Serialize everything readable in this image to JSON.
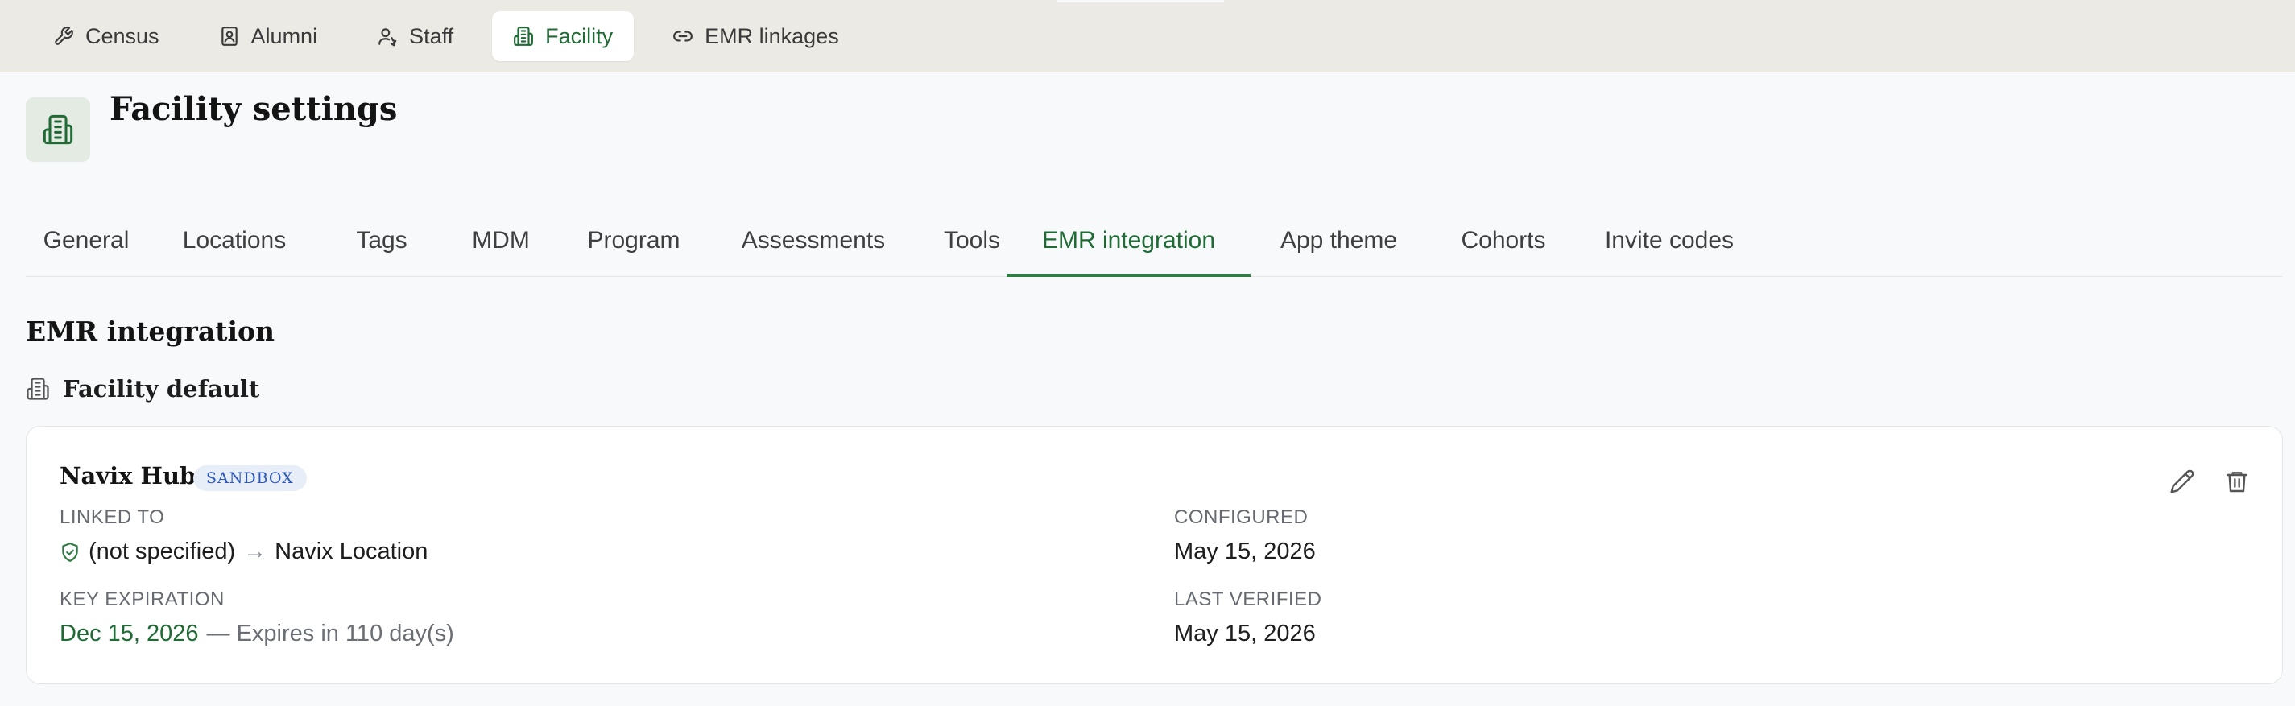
{
  "topnav": {
    "items": [
      {
        "label": "Census",
        "icon": "wrench-icon"
      },
      {
        "label": "Alumni",
        "icon": "contact-card-icon"
      },
      {
        "label": "Staff",
        "icon": "user-icon"
      },
      {
        "label": "Facility",
        "icon": "building-icon",
        "active": true
      },
      {
        "label": "EMR linkages",
        "icon": "link-icon"
      }
    ]
  },
  "header": {
    "title": "Facility settings",
    "icon": "building-icon"
  },
  "tabs": [
    {
      "label": "General"
    },
    {
      "label": "Locations"
    },
    {
      "label": "Tags"
    },
    {
      "label": "MDM"
    },
    {
      "label": "Program"
    },
    {
      "label": "Assessments"
    },
    {
      "label": "Tools"
    },
    {
      "label": "EMR integration",
      "active": true
    },
    {
      "label": "App theme"
    },
    {
      "label": "Cohorts"
    },
    {
      "label": "Invite codes"
    }
  ],
  "section": {
    "title": "EMR integration",
    "subsection": "Facility default"
  },
  "card": {
    "name": "Navix Hub",
    "badge": "SANDBOX",
    "linked_to": {
      "label": "LINKED TO",
      "from": "(not specified)",
      "arrow": "→",
      "to": "Navix Location"
    },
    "configured": {
      "label": "CONFIGURED",
      "value": "May 15, 2026"
    },
    "key_expiration": {
      "label": "KEY EXPIRATION",
      "date": "Dec 15, 2026",
      "note": "— Expires in 110 day(s)"
    },
    "last_verified": {
      "label": "LAST VERIFIED",
      "value": "May 15, 2026"
    }
  },
  "colors": {
    "accent": "#1f6a35",
    "badge_text": "#2a57b8",
    "badge_bg": "#e8eef8",
    "topbar_bg": "#eceae5",
    "page_bg": "#f7f9fb"
  }
}
